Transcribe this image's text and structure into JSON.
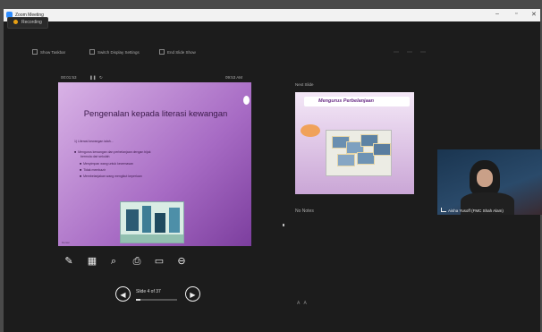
{
  "window": {
    "title": "Zoom Meeting",
    "controls": {
      "minimize": "–",
      "maximize": "▫",
      "close": "✕"
    }
  },
  "recording": {
    "label": "Recording"
  },
  "toolbar": {
    "items": [
      {
        "label": "Show Taskbar",
        "icon": "taskbar-icon"
      },
      {
        "label": "Switch Display Settings",
        "icon": "monitor-icon"
      },
      {
        "label": "End Slide Show",
        "icon": "end-show-icon"
      }
    ]
  },
  "presenter": {
    "timer": "00:01:53",
    "clock": "09:53 AM",
    "current_slide": {
      "title": "Pengenalan kepada literasi kewangan",
      "paragraphs": [
        {
          "text": "1) Literasi kewangan ialah..."
        },
        {
          "text": "Mengurus kewangan dan perbelanjaan dengan bijak",
          "bullet": true
        },
        {
          "text": "bermula dari sekolah",
          "bullet": false
        },
        {
          "text": "Menyimpan wang untuk kecemasan",
          "bullet": true
        },
        {
          "text": "Tidak membazir",
          "bullet": true
        },
        {
          "text": "Membelanjakan wang mengikut keperluan",
          "bullet": true
        }
      ],
      "footer": "literasi"
    },
    "tools": [
      "pen-icon",
      "slide-grid-icon",
      "zoom-icon",
      "pointer-icon",
      "black-screen-icon",
      "more-options-icon"
    ],
    "slide_counter": "Slide 4 of 37",
    "progress_fraction": 0.11
  },
  "next_slide": {
    "label": "Next Slide",
    "title": "Mengurus Perbelanjaan"
  },
  "notes": {
    "label": "No Notes"
  },
  "participant": {
    "name": "Aisha Yusoff (FMC Shah Alam)"
  }
}
